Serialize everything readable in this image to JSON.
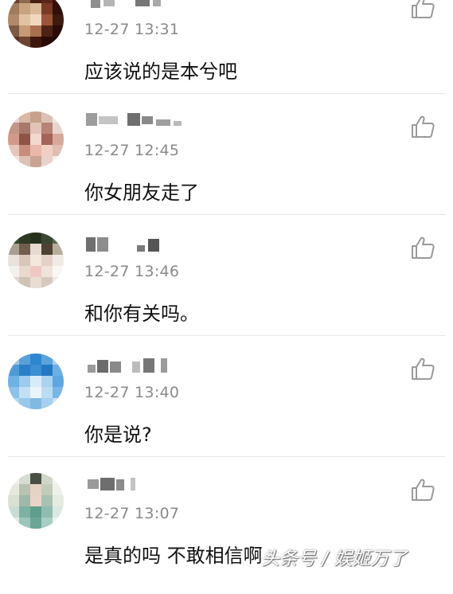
{
  "comments": [
    {
      "time": "12-27 13:31",
      "text": "应该说的是本兮吧"
    },
    {
      "time": "12-27 12:45",
      "text": "你女朋友走了"
    },
    {
      "time": "12-27 13:46",
      "text": "和你有关吗。"
    },
    {
      "time": "12-27 13:40",
      "text": "你是说?"
    },
    {
      "time": "12-27 13:07",
      "text": "是真的吗 不敢相信啊"
    }
  ],
  "watermark": "头条号 / 娱姬万了",
  "icons": {
    "like": "thumbs-up-icon"
  },
  "colors": {
    "time": "#8a8a8a",
    "divider": "#e6e6e6",
    "icon": "#9a9a9a"
  }
}
